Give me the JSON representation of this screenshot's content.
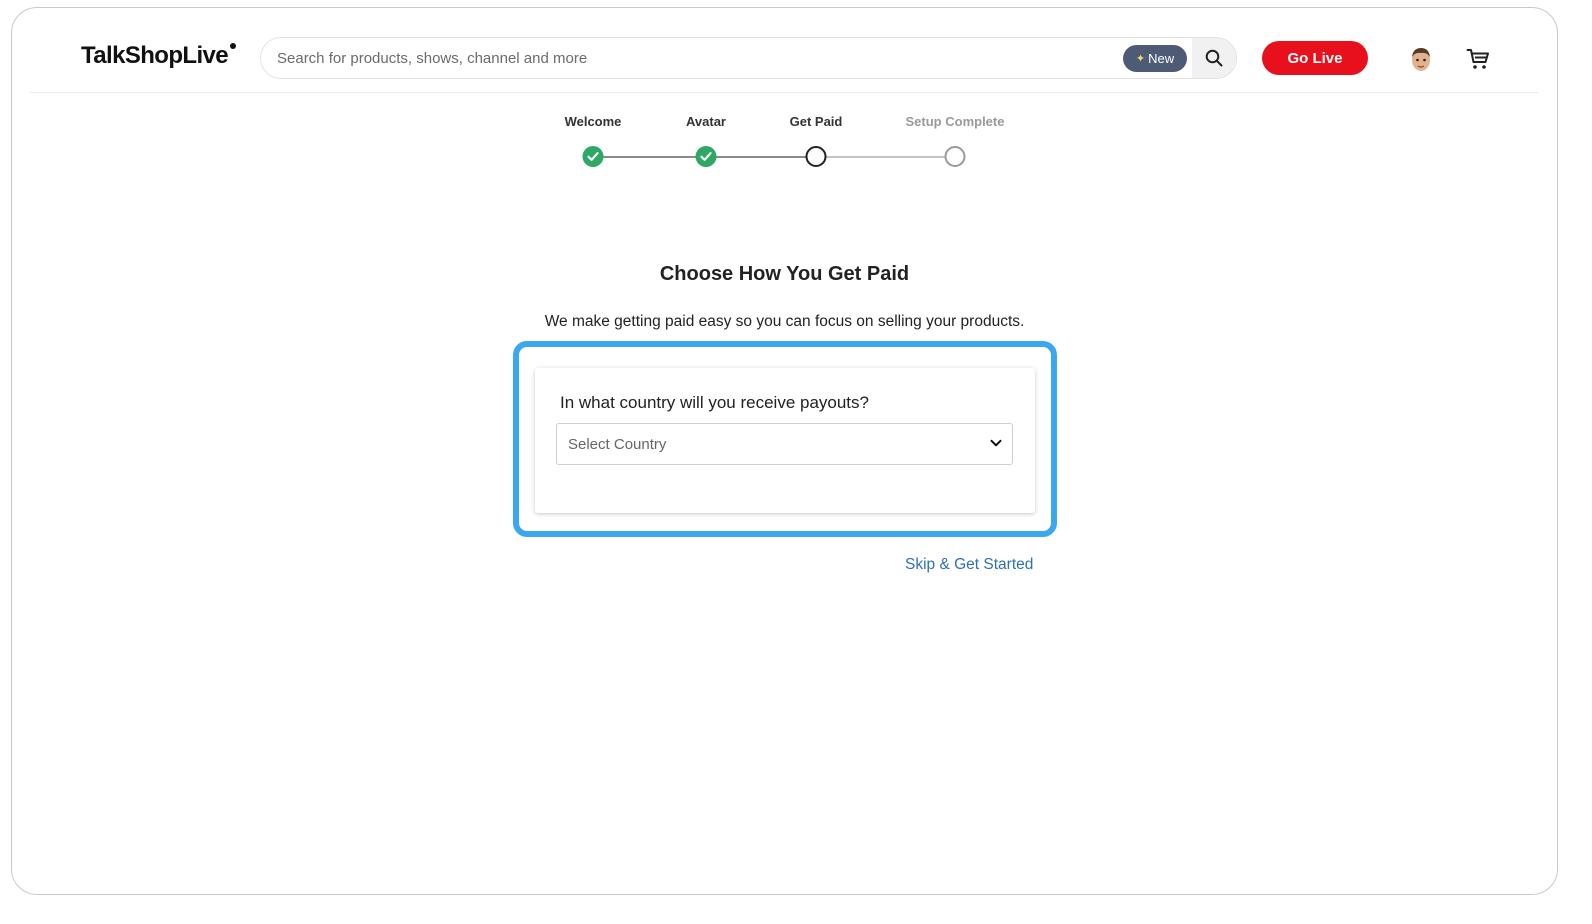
{
  "header": {
    "logo": "TalkShopLive",
    "search_placeholder": "Search for products, shows, channel and more",
    "new_badge": "New",
    "go_live_label": "Go Live"
  },
  "stepper": {
    "steps": [
      {
        "label": "Welcome",
        "state": "complete"
      },
      {
        "label": "Avatar",
        "state": "complete"
      },
      {
        "label": "Get Paid",
        "state": "current"
      },
      {
        "label": "Setup Complete",
        "state": "upcoming"
      }
    ]
  },
  "main": {
    "title": "Choose How You Get Paid",
    "subtitle": "We make getting paid easy so you can focus on selling your products.",
    "question": "In what country will you receive payouts?",
    "country_select": "Select Country",
    "skip_link": "Skip & Get Started"
  },
  "colors": {
    "brand_red": "#e8101c",
    "step_complete": "#2ea865",
    "highlight": "#3aa7f0",
    "link": "#2f6fb4"
  },
  "icons": [
    "search-icon",
    "avatar",
    "cart-icon",
    "check-icon",
    "chevron-down-icon",
    "sparkle-icon"
  ]
}
